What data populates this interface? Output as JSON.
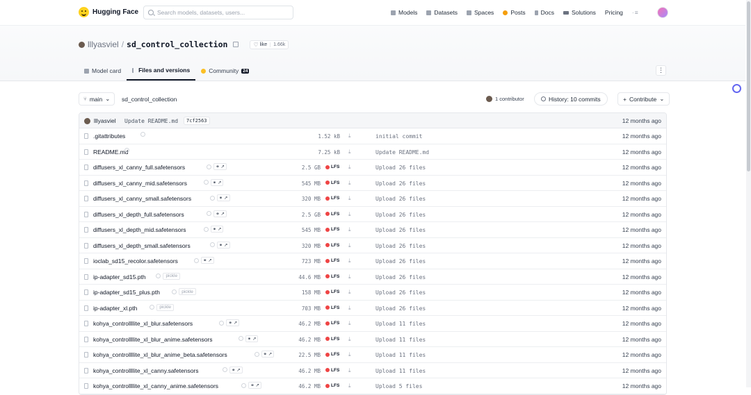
{
  "nav": {
    "brand": "Hugging Face",
    "search_placeholder": "Search models, datasets, users...",
    "links": [
      "Models",
      "Datasets",
      "Spaces",
      "Posts",
      "Docs",
      "Solutions",
      "Pricing"
    ]
  },
  "repo": {
    "owner": "lllyasviel",
    "separator": "/",
    "name": "sd_control_collection",
    "like_label": "like",
    "like_count": "1.66k"
  },
  "tabs": [
    {
      "label": "Model card"
    },
    {
      "label": "Files and versions"
    },
    {
      "label": "Community",
      "badge": "24"
    }
  ],
  "toolbar": {
    "branch": "main",
    "path": "sd_control_collection",
    "contributors": "1 contributor",
    "history": "History: 10 commits",
    "contribute": "Contribute"
  },
  "last_commit": {
    "author": "lllyasviel",
    "message": "Update README.md",
    "hash": "7cf2563",
    "time": "12 months ago"
  },
  "files": [
    {
      "name": ".gitattributes",
      "size": "1.52 kB",
      "lfs": false,
      "tag": "",
      "commit": "initial commit",
      "time": "12 months ago"
    },
    {
      "name": "README.md",
      "size": "7.25 kB",
      "lfs": false,
      "tag": "",
      "commit": "Update README.md",
      "time": "12 months ago"
    },
    {
      "name": "diffusers_xl_canny_full.safetensors",
      "size": "2.5 GB",
      "lfs": true,
      "tag": "safe",
      "commit": "Upload 26 files",
      "time": "12 months ago"
    },
    {
      "name": "diffusers_xl_canny_mid.safetensors",
      "size": "545 MB",
      "lfs": true,
      "tag": "safe",
      "commit": "Upload 26 files",
      "time": "12 months ago"
    },
    {
      "name": "diffusers_xl_canny_small.safetensors",
      "size": "320 MB",
      "lfs": true,
      "tag": "safe",
      "commit": "Upload 26 files",
      "time": "12 months ago"
    },
    {
      "name": "diffusers_xl_depth_full.safetensors",
      "size": "2.5 GB",
      "lfs": true,
      "tag": "safe",
      "commit": "Upload 26 files",
      "time": "12 months ago"
    },
    {
      "name": "diffusers_xl_depth_mid.safetensors",
      "size": "545 MB",
      "lfs": true,
      "tag": "safe",
      "commit": "Upload 26 files",
      "time": "12 months ago"
    },
    {
      "name": "diffusers_xl_depth_small.safetensors",
      "size": "320 MB",
      "lfs": true,
      "tag": "safe",
      "commit": "Upload 26 files",
      "time": "12 months ago"
    },
    {
      "name": "ioclab_sd15_recolor.safetensors",
      "size": "723 MB",
      "lfs": true,
      "tag": "safe",
      "commit": "Upload 26 files",
      "time": "12 months ago"
    },
    {
      "name": "ip-adapter_sd15.pth",
      "size": "44.6 MB",
      "lfs": true,
      "tag": "pickle",
      "commit": "Upload 26 files",
      "time": "12 months ago"
    },
    {
      "name": "ip-adapter_sd15_plus.pth",
      "size": "158 MB",
      "lfs": true,
      "tag": "pickle",
      "commit": "Upload 26 files",
      "time": "12 months ago"
    },
    {
      "name": "ip-adapter_xl.pth",
      "size": "703 MB",
      "lfs": true,
      "tag": "pickle",
      "commit": "Upload 26 files",
      "time": "12 months ago"
    },
    {
      "name": "kohya_controllllite_xl_blur.safetensors",
      "size": "46.2 MB",
      "lfs": true,
      "tag": "safe",
      "commit": "Upload 11 files",
      "time": "12 months ago"
    },
    {
      "name": "kohya_controllllite_xl_blur_anime.safetensors",
      "size": "46.2 MB",
      "lfs": true,
      "tag": "safe",
      "commit": "Upload 11 files",
      "time": "12 months ago"
    },
    {
      "name": "kohya_controllllite_xl_blur_anime_beta.safetensors",
      "size": "22.5 MB",
      "lfs": true,
      "tag": "safe",
      "commit": "Upload 11 files",
      "time": "12 months ago"
    },
    {
      "name": "kohya_controllllite_xl_canny.safetensors",
      "size": "46.2 MB",
      "lfs": true,
      "tag": "safe",
      "commit": "Upload 11 files",
      "time": "12 months ago"
    },
    {
      "name": "kohya_controllllite_xl_canny_anime.safetensors",
      "size": "46.2 MB",
      "lfs": true,
      "tag": "safe",
      "commit": "Upload 5 files",
      "time": "12 months ago"
    }
  ],
  "labels": {
    "lfs": "LFS",
    "pickle": "pickle"
  }
}
